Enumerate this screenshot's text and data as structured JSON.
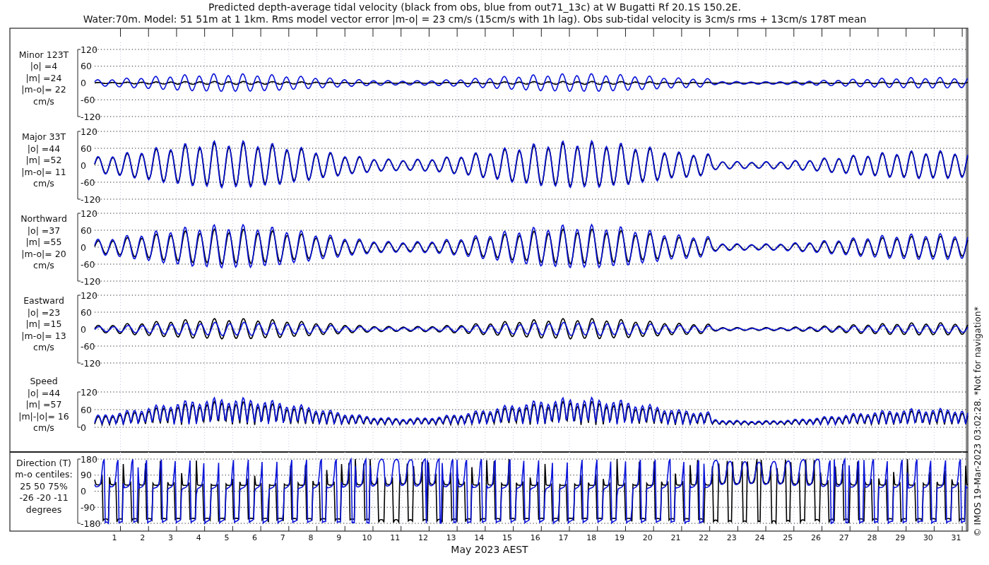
{
  "title": "Predicted depth-average tidal velocity (black from obs, blue from out71_13c) at W Bugatti Rf 20.1S 150.2E.",
  "subtitle": "Water:70m. Model: 51 51m at 1 1km. Rms model vector error |m-o| = 23 cm/s (15cm/s with 1h lag). Obs sub-tidal velocity is 3cm/s rms + 13cm/s 178T mean",
  "panels": [
    {
      "kind": "velocity",
      "label_lines": [
        "Minor 123T",
        "|o| =4",
        "|m| =24",
        "|m-o|= 22",
        "cm/s"
      ],
      "yticks": [
        "120",
        "60",
        "0",
        "-60",
        "-120"
      ]
    },
    {
      "kind": "velocity",
      "label_lines": [
        "Major 33T",
        "|o| =44",
        "|m| =52",
        "|m-o|= 11",
        "cm/s"
      ],
      "yticks": [
        "120",
        "60",
        "0",
        "-60",
        "-120"
      ]
    },
    {
      "kind": "velocity",
      "label_lines": [
        "Northward",
        "|o| =37",
        "|m| =55",
        "|m-o|= 20",
        "cm/s"
      ],
      "yticks": [
        "120",
        "60",
        "0",
        "-60",
        "-120"
      ]
    },
    {
      "kind": "velocity",
      "label_lines": [
        "Eastward",
        "|o| =23",
        "|m| =15",
        "|m-o|= 13",
        "cm/s"
      ],
      "yticks": [
        "120",
        "60",
        "0",
        "-60",
        "-120"
      ]
    },
    {
      "kind": "speed",
      "label_lines": [
        "Speed",
        "|o| =44",
        "|m| =57",
        "|m|-|o|= 16",
        "cm/s"
      ],
      "yticks": [
        "120",
        "60",
        "0"
      ]
    },
    {
      "kind": "direction",
      "label_lines": [
        "Direction (T)",
        "m-o centiles:",
        "25  50  75%",
        "-26 -20 -11",
        "degrees"
      ],
      "yticks": [
        "180",
        "90",
        "0",
        "-90",
        "-180"
      ]
    }
  ],
  "x_axis": {
    "day_labels": [
      "1",
      "2",
      "3",
      "4",
      "5",
      "6",
      "7",
      "8",
      "9",
      "10",
      "11",
      "12",
      "13",
      "14",
      "15",
      "16",
      "17",
      "18",
      "19",
      "20",
      "21",
      "22",
      "23",
      "24",
      "25",
      "26",
      "27",
      "28",
      "29",
      "30",
      "31"
    ],
    "label": "May 2023 AEST"
  },
  "credit": "© IMOS 19-Mar-2023 03:02:28. *Not for navigation*"
}
